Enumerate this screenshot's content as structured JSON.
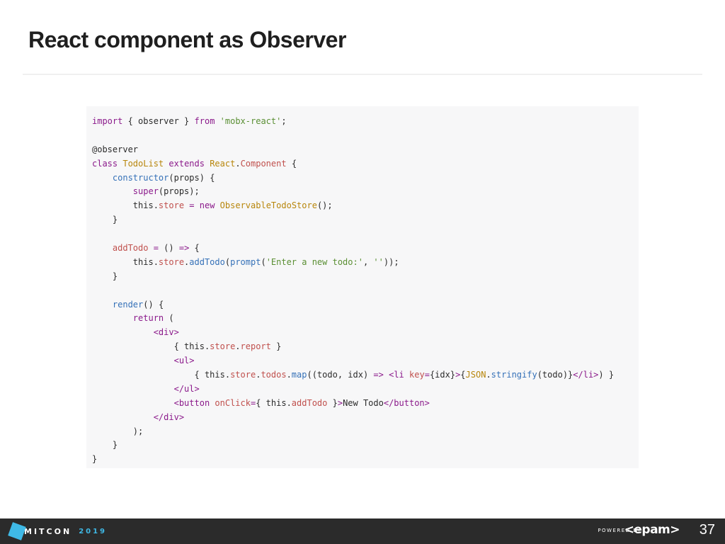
{
  "slide": {
    "title": "React component as Observer"
  },
  "code": {
    "lines": [
      [
        [
          "kw",
          "import"
        ],
        [
          "plain",
          " { observer } "
        ],
        [
          "kw",
          "from"
        ],
        [
          "plain",
          " "
        ],
        [
          "str",
          "'mobx-react'"
        ],
        [
          "plain",
          ";"
        ]
      ],
      [],
      [
        [
          "plain",
          "@observer"
        ]
      ],
      [
        [
          "kw",
          "class"
        ],
        [
          "plain",
          " "
        ],
        [
          "cls",
          "TodoList"
        ],
        [
          "plain",
          " "
        ],
        [
          "kw",
          "extends"
        ],
        [
          "plain",
          " "
        ],
        [
          "cls",
          "React"
        ],
        [
          "plain",
          "."
        ],
        [
          "prop",
          "Component"
        ],
        [
          "plain",
          " {"
        ]
      ],
      [
        [
          "plain",
          "    "
        ],
        [
          "fn",
          "constructor"
        ],
        [
          "plain",
          "(props) {"
        ]
      ],
      [
        [
          "plain",
          "        "
        ],
        [
          "kw",
          "super"
        ],
        [
          "plain",
          "(props);"
        ]
      ],
      [
        [
          "plain",
          "        this."
        ],
        [
          "prop",
          "store"
        ],
        [
          "plain",
          " "
        ],
        [
          "kw",
          "="
        ],
        [
          "plain",
          " "
        ],
        [
          "kw",
          "new"
        ],
        [
          "plain",
          " "
        ],
        [
          "cls",
          "ObservableTodoStore"
        ],
        [
          "plain",
          "();"
        ]
      ],
      [
        [
          "plain",
          "    }"
        ]
      ],
      [],
      [
        [
          "plain",
          "    "
        ],
        [
          "prop",
          "addTodo"
        ],
        [
          "plain",
          " "
        ],
        [
          "kw",
          "="
        ],
        [
          "plain",
          " () "
        ],
        [
          "kw",
          "=>"
        ],
        [
          "plain",
          " {"
        ]
      ],
      [
        [
          "plain",
          "        this."
        ],
        [
          "prop",
          "store"
        ],
        [
          "plain",
          "."
        ],
        [
          "fn",
          "addTodo"
        ],
        [
          "plain",
          "("
        ],
        [
          "fn",
          "prompt"
        ],
        [
          "plain",
          "("
        ],
        [
          "str",
          "'Enter a new todo:'"
        ],
        [
          "plain",
          ", "
        ],
        [
          "str",
          "''"
        ],
        [
          "plain",
          "));"
        ]
      ],
      [
        [
          "plain",
          "    }"
        ]
      ],
      [],
      [
        [
          "plain",
          "    "
        ],
        [
          "fn",
          "render"
        ],
        [
          "plain",
          "() {"
        ]
      ],
      [
        [
          "plain",
          "        "
        ],
        [
          "kw",
          "return"
        ],
        [
          "plain",
          " ("
        ]
      ],
      [
        [
          "plain",
          "            "
        ],
        [
          "tag",
          "<div>"
        ]
      ],
      [
        [
          "plain",
          "                { this."
        ],
        [
          "prop",
          "store"
        ],
        [
          "plain",
          "."
        ],
        [
          "prop",
          "report"
        ],
        [
          "plain",
          " }"
        ]
      ],
      [
        [
          "plain",
          "                "
        ],
        [
          "tag",
          "<ul>"
        ]
      ],
      [
        [
          "plain",
          "                    { this."
        ],
        [
          "prop",
          "store"
        ],
        [
          "plain",
          "."
        ],
        [
          "prop",
          "todos"
        ],
        [
          "plain",
          "."
        ],
        [
          "fn",
          "map"
        ],
        [
          "plain",
          "((todo, idx) "
        ],
        [
          "kw",
          "=>"
        ],
        [
          "plain",
          " "
        ],
        [
          "tag",
          "<li"
        ],
        [
          "plain",
          " "
        ],
        [
          "prop",
          "key"
        ],
        [
          "kw",
          "="
        ],
        [
          "plain",
          "{idx}"
        ],
        [
          "tag",
          ">"
        ],
        [
          "plain",
          "{"
        ],
        [
          "cls",
          "JSON"
        ],
        [
          "plain",
          "."
        ],
        [
          "fn",
          "stringify"
        ],
        [
          "plain",
          "(todo)}"
        ],
        [
          "tag",
          "</li>"
        ],
        [
          "plain",
          ") }"
        ]
      ],
      [
        [
          "plain",
          "                "
        ],
        [
          "tag",
          "</ul>"
        ]
      ],
      [
        [
          "plain",
          "                "
        ],
        [
          "tag",
          "<button"
        ],
        [
          "plain",
          " "
        ],
        [
          "prop",
          "onClick"
        ],
        [
          "kw",
          "="
        ],
        [
          "plain",
          "{ this."
        ],
        [
          "prop",
          "addTodo"
        ],
        [
          "plain",
          " }"
        ],
        [
          "tag",
          ">"
        ],
        [
          "plain",
          "New Todo"
        ],
        [
          "tag",
          "</button>"
        ]
      ],
      [
        [
          "plain",
          "            "
        ],
        [
          "tag",
          "</div>"
        ]
      ],
      [
        [
          "plain",
          "        );"
        ]
      ],
      [
        [
          "plain",
          "    }"
        ]
      ],
      [
        [
          "plain",
          "}"
        ]
      ]
    ]
  },
  "footer": {
    "conference_name": "MITCON",
    "conference_year": "2019",
    "powered_by": "POWERED BY",
    "brand": "<epam>",
    "page_number": "37"
  },
  "colors": {
    "keyword": "#8b1a8b",
    "string": "#5a8f33",
    "function": "#3571b8",
    "class": "#b8860b",
    "property": "#c0504d",
    "footer_bg": "#2b2b2b",
    "accent": "#3fb9e6"
  }
}
